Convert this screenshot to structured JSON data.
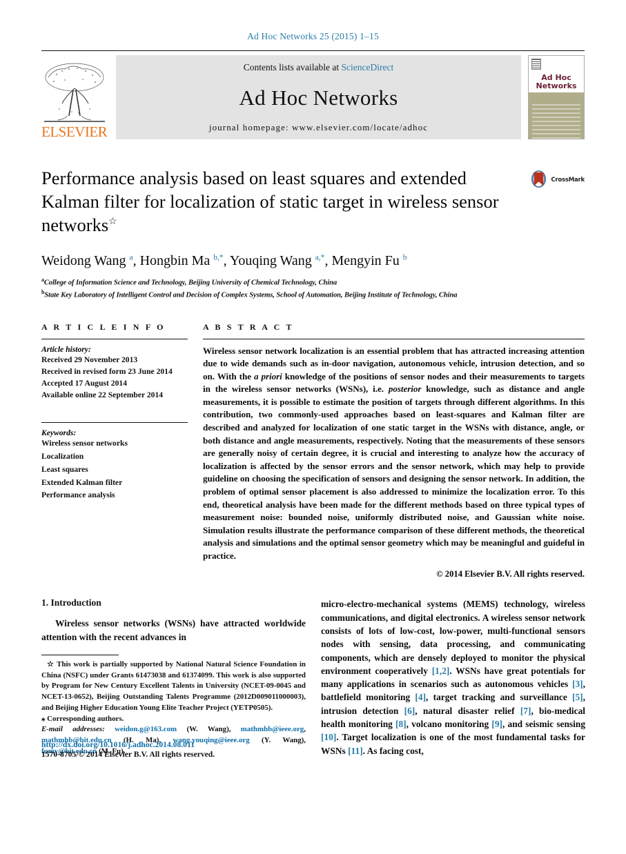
{
  "running_head": "Ad Hoc Networks 25 (2015) 1–15",
  "masthead": {
    "contents_prefix": "Contents lists available at ",
    "sciencedirect": "ScienceDirect",
    "journal_name": "Ad Hoc Networks",
    "homepage": "journal homepage: www.elsevier.com/locate/adhoc",
    "publisher": "ELSEVIER",
    "cover_title": "Ad Hoc\nNetworks"
  },
  "title": {
    "text": "Performance analysis based on least squares and extended Kalman filter for localization of static target in wireless sensor networks",
    "footnote_marker": "☆"
  },
  "crossmark": {
    "label": "CrossMark"
  },
  "authors_html": "Weidong Wang <sup>a</sup>, Hongbin Ma <sup>b,*</sup>, Youqing Wang <sup>a,*</sup>, Mengyin Fu <sup>b</sup>",
  "affiliations": [
    {
      "marker": "a",
      "text": "College of Information Science and Technology, Beijing University of Chemical Technology, China"
    },
    {
      "marker": "b",
      "text": "State Key Laboratory of Intelligent Control and Decision of Complex Systems, School of Automation, Beijing Institute of Technology, China"
    }
  ],
  "article_info": {
    "heading": "A R T I C L E   I N F O",
    "history_label": "Article history:",
    "history": [
      "Received 29 November 2013",
      "Received in revised form 23 June 2014",
      "Accepted 17 August 2014",
      "Available online 22 September 2014"
    ],
    "keywords_label": "Keywords:",
    "keywords": [
      "Wireless sensor networks",
      "Localization",
      "Least squares",
      "Extended Kalman filter",
      "Performance analysis"
    ]
  },
  "abstract": {
    "heading": "A B S T R A C T",
    "text_html": "Wireless sensor network localization is an essential problem that has attracted increasing attention due to wide demands such as in-door navigation, autonomous vehicle, intrusion detection, and so on. With the <i>a priori</i> knowledge of the positions of sensor nodes and their measurements to targets in the wireless sensor networks (WSNs), i.e. <i>posterior</i> knowledge, such as distance and angle measurements, it is possible to estimate the position of targets through different algorithms. In this contribution, two commonly-used approaches based on least-squares and Kalman filter are described and analyzed for localization of one static target in the WSNs with distance, angle, or both distance and angle measurements, respectively. Noting that the measurements of these sensors are generally noisy of certain degree, it is crucial and interesting to analyze how the accuracy of localization is affected by the sensor errors and the sensor network, which may help to provide guideline on choosing the specification of sensors and designing the sensor network. In addition, the problem of optimal sensor placement is also addressed to minimize the localization error. To this end, theoretical analysis have been made for the different methods based on three typical types of measurement noise: bounded noise, uniformly distributed noise, and Gaussian white noise. Simulation results illustrate the performance comparison of these different methods, the theoretical analysis and simulations and the optimal sensor geometry which may be meaningful and guideful in practice.",
    "copyright": "© 2014 Elsevier B.V. All rights reserved."
  },
  "introduction": {
    "heading": "1. Introduction",
    "left_para_html": "Wireless sensor networks (WSNs) have attracted worldwide attention with the recent advances in",
    "right_para_html": "micro-electro-mechanical systems (MEMS) technology, wireless communications, and digital electronics. A wireless sensor network consists of lots of low-cost, low-power, multi-functional sensors nodes with sensing, data processing, and communicating components, which are densely deployed to monitor the physical environment cooperatively <span class=\"ref\">[1,2]</span>. WSNs have great potentials for many applications in scenarios such as autonomous vehicles <span class=\"ref\">[3]</span>, battlefield monitoring <span class=\"ref\">[4]</span>, target tracking and surveillance <span class=\"ref\">[5]</span>, intrusion detection <span class=\"ref\">[6]</span>, natural disaster relief <span class=\"ref\">[7]</span>, bio-medical health monitoring <span class=\"ref\">[8]</span>, volcano monitoring <span class=\"ref\">[9]</span>, and seismic sensing <span class=\"ref\">[10]</span>. Target localization is one of the most fundamental tasks for WSNs <span class=\"ref\">[11]</span>. As facing cost,"
  },
  "footnotes": {
    "funding_html": "<span class=\"lead\">&#9734; This work is partially supported by National Natural Science Foundation in China (NSFC) under Grants 61473038 and 61374099. This work is also supported by Program for New Century Excellent Talents in University (NCET-09-0045 and NCET-13-0652), Beijing Outstanding Talents Programme (2012D009011000003), and Beijing Higher Education Young Elite Teacher Project (YETP0505).</span>",
    "corresponding": "⁎ Corresponding authors.",
    "emails_html": "<i>E-mail addresses:</i> <span class=\"link\">weidon.g@163.com</span> (W. Wang), <span class=\"link\">mathmhb@ieee.org</span>, <span class=\"link\">mathmhb@bit.edu.cn</span> (H. Ma), <span class=\"link\">wang.youqing@ieee.org</span> (Y. Wang), <span class=\"link\">fumy@bit.edu.cn</span> (M. Fu)."
  },
  "footer": {
    "doi": "http://dx.doi.org/10.1016/j.adhoc.2014.08.011",
    "issn_line": "1570-8705/© 2014 Elsevier B.V. All rights reserved."
  },
  "colors": {
    "link_blue": "#0f6fa8",
    "header_blue": "#2a7ca6",
    "elsevier_orange": "#E87722",
    "banner_gray": "#e3e3e3",
    "cover_olive": "#b0ad8a",
    "cover_maroon": "#6b1f33",
    "crossmark_red": "#b9321f"
  }
}
